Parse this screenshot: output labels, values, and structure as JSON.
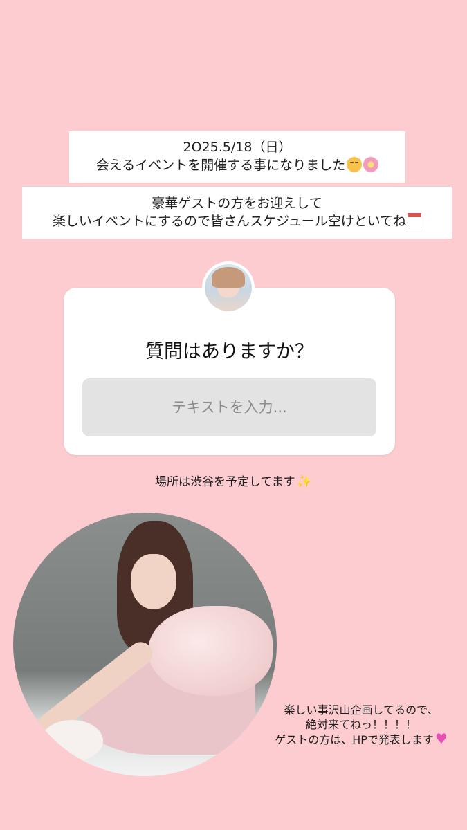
{
  "caption1": {
    "line1": "2O25.5/18（日）",
    "line2": "会えるイベントを開催する事になりました",
    "emojis": [
      "smiling-face-icon",
      "cherry-blossom-icon"
    ]
  },
  "caption2": {
    "line1": "豪華ゲストの方をお迎えして",
    "line2": "楽しいイベントにするので皆さんスケジュール空けといてね",
    "emojis": [
      "calendar-icon"
    ]
  },
  "question_sticker": {
    "question": "質問はありますか？",
    "input_placeholder": "テキストを入力..."
  },
  "place_text": "場所は渋谷を予定してます",
  "bottom_text": {
    "line1": "楽しい事沢山企画してるので、",
    "line2": "絶対来てねっ！！！！",
    "line3": "ゲストの方は、HPで発表します"
  },
  "colors": {
    "background": "#fdccd0",
    "card": "#ffffff",
    "input_bg": "#e3e3e3"
  }
}
